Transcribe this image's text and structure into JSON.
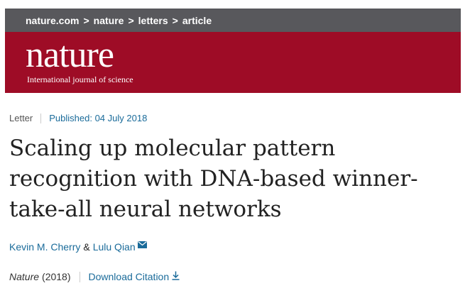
{
  "breadcrumb": {
    "items": [
      "nature.com",
      "nature",
      "letters",
      "article"
    ],
    "separator": ">"
  },
  "masthead": {
    "logo": "nature",
    "tagline": "International journal of science",
    "background_color": "#9e0c26"
  },
  "article_meta": {
    "type": "Letter",
    "published": "Published: 04 July 2018"
  },
  "article": {
    "title": "Scaling up molecular pattern recognition with DNA-based winner-take-all neural networks",
    "authors": [
      {
        "name": "Kevin M. Cherry"
      },
      {
        "name": "Lulu Qian",
        "icon": "mail-icon"
      }
    ],
    "author_joiner": "&"
  },
  "citation": {
    "journal": "Nature",
    "year": "(2018)",
    "download_label": "Download Citation",
    "download_icon": "download-icon"
  },
  "colors": {
    "link": "#1a6b9a",
    "breadcrumb_bar": "#58585c"
  }
}
